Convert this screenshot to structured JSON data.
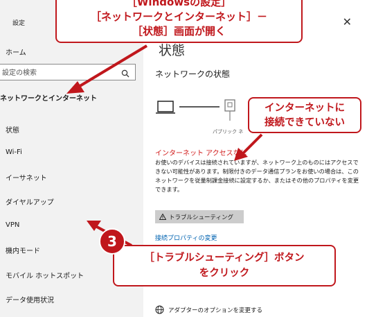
{
  "sidebar": {
    "title": "設定",
    "home": "ホーム",
    "search_placeholder": "設定の検索",
    "section": "ネットワークとインターネット",
    "items": [
      "状態",
      "Wi-Fi",
      "イーサネット",
      "ダイヤルアップ",
      "VPN",
      "機内モード",
      "モバイル ホットスポット",
      "データ使用状況"
    ]
  },
  "main": {
    "close_glyph": "✕",
    "page_title": "状態",
    "network_heading": "ネットワークの状態",
    "public_label": "パブリック ネ",
    "status_text": "インターネット アクセスなし",
    "description": "お使いのデバイスは接続されていますが、ネットワーク上のものにはアクセスできない可能性があります。制限付きのデータ通信プランをお使いの場合は、このネットワークを従量制課金接続に設定するか、またはその他のプロパティを変更できます。",
    "troubleshoot_button": "トラブルシューティング",
    "change_link": "接続プロパティの変更",
    "adapter_options": "アダプターのオプションを変更する"
  },
  "callouts": {
    "top_line1": "［Windowsの設定］",
    "top_line2": "［ネットワークとインターネット］－",
    "top_line3": "［状態］画面が開く",
    "right_line1": "インターネットに",
    "right_line2": "接続できていない",
    "bottom_line1": "［トラブルシューティング］ボタン",
    "bottom_line2": "をクリック",
    "badge_number": "3"
  },
  "colors": {
    "accent_red": "#c0171c",
    "status_red": "#d11a1a",
    "link_blue": "#0063b1",
    "sidebar_bg": "#f2f2f2"
  }
}
